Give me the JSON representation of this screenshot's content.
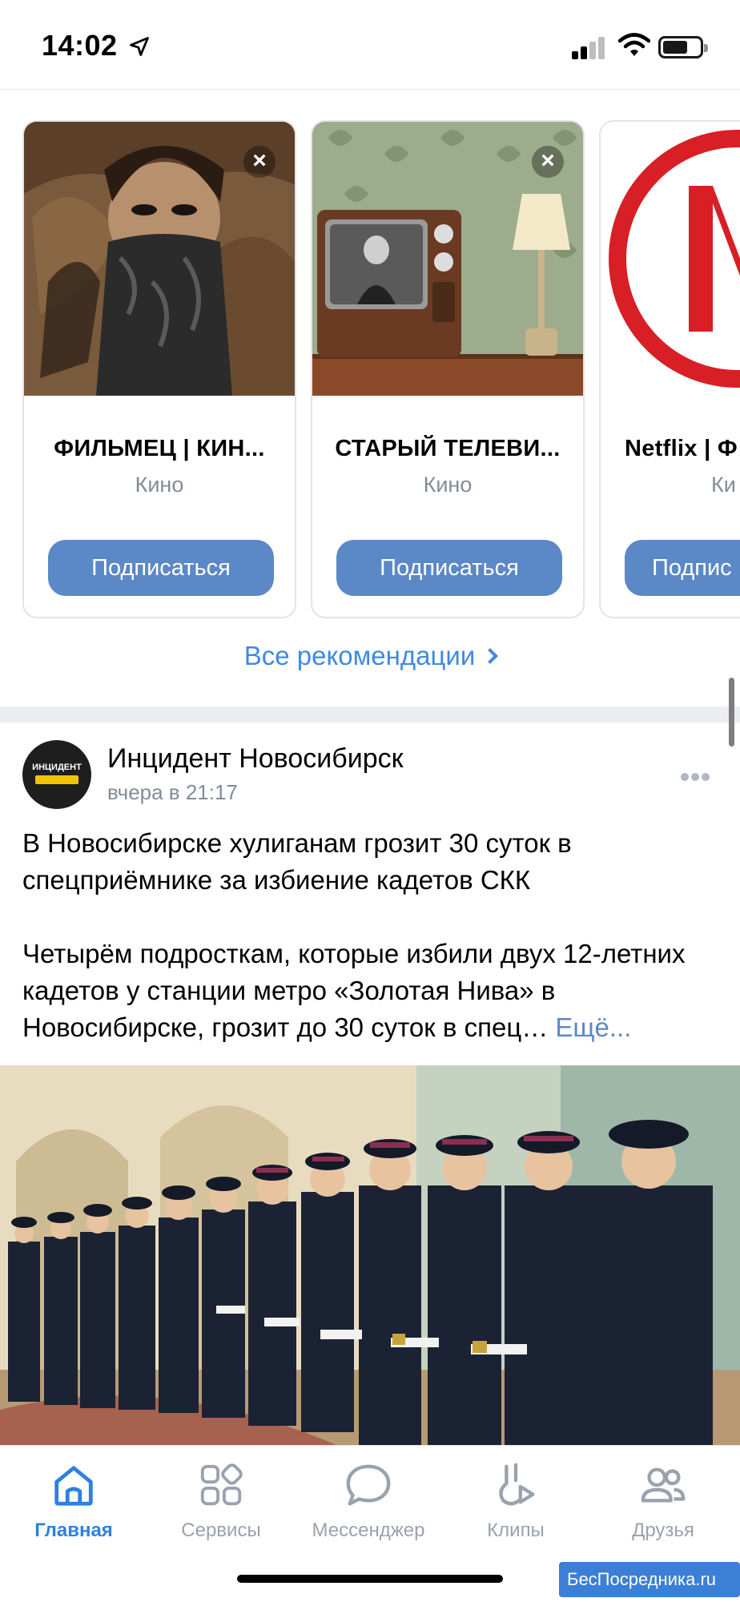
{
  "status_bar": {
    "time": "14:02",
    "location_icon": "location-arrow-icon",
    "signal_icon": "cellular-signal-icon",
    "wifi_icon": "wifi-icon",
    "battery_icon": "battery-icon"
  },
  "recommendations": {
    "cards": [
      {
        "title": "ФИЛЬМЕЦ | КИН...",
        "subtitle": "Кино",
        "button": "Подписаться",
        "close": "×"
      },
      {
        "title": "СТАРЫЙ ТЕЛЕВИ...",
        "subtitle": "Кино",
        "button": "Подписаться",
        "close": "×"
      },
      {
        "title": "Netflix | Ф",
        "subtitle": "Ки",
        "button": "Подпис"
      }
    ],
    "all_link": "Все рекомендации"
  },
  "post": {
    "author": "Инцидент Новосибирск",
    "time": "вчера в 21:17",
    "avatar_text": "ИНЦИДЕНТ",
    "paragraph1": "В Новосибирске хулиганам грозит 30 суток в спецприёмнике за избиение кадетов СКК",
    "paragraph2": "Четырём подросткам, которые избили двух 12-летних кадетов у станции метро «Золотая Нива» в Новосибирске, грозит до 30 суток в спец…",
    "more": "Ещё..."
  },
  "tab_bar": {
    "tabs": [
      {
        "label": "Главная",
        "icon": "home-icon",
        "active": true
      },
      {
        "label": "Сервисы",
        "icon": "services-grid-icon",
        "active": false
      },
      {
        "label": "Мессенджер",
        "icon": "messenger-bubble-icon",
        "active": false
      },
      {
        "label": "Клипы",
        "icon": "clips-icon",
        "active": false
      },
      {
        "label": "Друзья",
        "icon": "friends-icon",
        "active": false
      }
    ]
  },
  "watermark": "БесПосредника.ru",
  "colors": {
    "accent": "#2d81e0",
    "button": "#5b88c6",
    "secondary_text": "#818c99"
  }
}
